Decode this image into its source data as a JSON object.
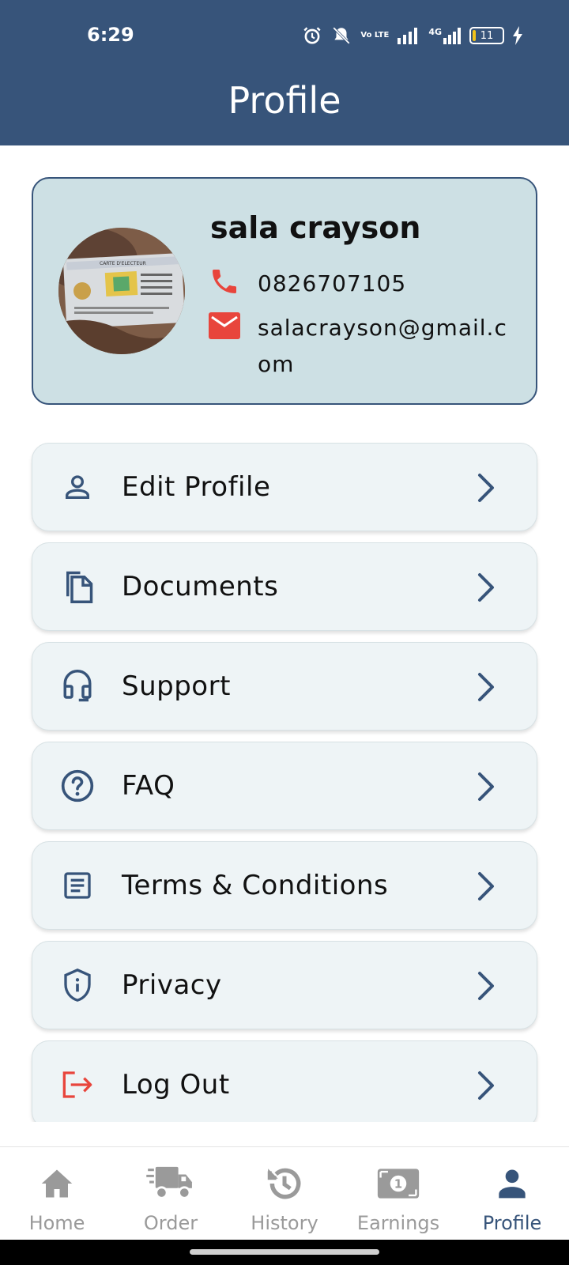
{
  "status_bar": {
    "time": "6:29",
    "battery": "11",
    "network": "4G",
    "volte": "Vo LTE"
  },
  "header": {
    "title": "Profile",
    "bg_color": "#37547a"
  },
  "profile": {
    "name": "sala crayson",
    "phone": "0826707105",
    "email": "salacrayson@gmail.com",
    "avatar_text": "CARTE D'ELECTEUR",
    "card_bg": "#cde0e4"
  },
  "menu": [
    {
      "label": "Edit Profile",
      "icon": "person-icon"
    },
    {
      "label": "Documents",
      "icon": "documents-icon"
    },
    {
      "label": "Support",
      "icon": "headset-icon"
    },
    {
      "label": "FAQ",
      "icon": "question-icon"
    },
    {
      "label": "Terms & Conditions",
      "icon": "list-document-icon"
    },
    {
      "label": "Privacy",
      "icon": "shield-info-icon"
    },
    {
      "label": "Log Out",
      "icon": "logout-icon"
    }
  ],
  "bottom_nav": [
    {
      "label": "Home",
      "icon": "home-icon",
      "active": false
    },
    {
      "label": "Order",
      "icon": "truck-icon",
      "active": false
    },
    {
      "label": "History",
      "icon": "history-icon",
      "active": false
    },
    {
      "label": "Earnings",
      "icon": "money-icon",
      "active": false
    },
    {
      "label": "Profile",
      "icon": "person-icon",
      "active": true
    }
  ],
  "colors": {
    "primary": "#37547a",
    "accent_red": "#e8453c",
    "inactive": "#9a9a9a"
  }
}
